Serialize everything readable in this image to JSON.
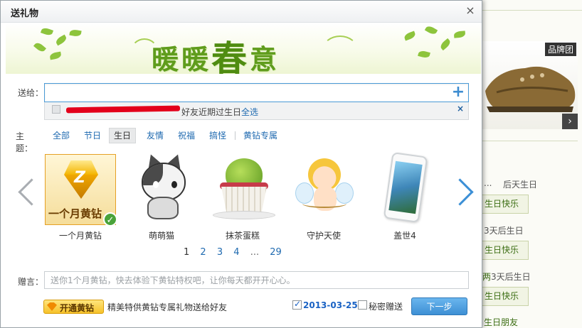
{
  "dialog": {
    "title": "送礼物",
    "close_symbol": "×",
    "banner_text": "暖暖",
    "banner_text_big": "春",
    "banner_text_end": "意",
    "recipient_label": "送给：",
    "add_symbol": "+",
    "suggestion": {
      "text": "好友近期过生日",
      "select_all": "全选",
      "close_symbol": "×"
    },
    "theme_label": "主题：",
    "tabs": [
      {
        "label": "全部",
        "active": false
      },
      {
        "label": "节日",
        "active": false
      },
      {
        "label": "生日",
        "active": true
      },
      {
        "label": "友情",
        "active": false
      },
      {
        "label": "祝福",
        "active": false
      },
      {
        "label": "搞怪",
        "active": false
      },
      {
        "label": "黄钻专属",
        "active": false
      }
    ],
    "gifts": [
      {
        "name": "一个月黄钻",
        "caption": "一个月黄钻",
        "selected": true
      },
      {
        "name": "萌萌猫",
        "selected": false
      },
      {
        "name": "抹茶蛋糕",
        "selected": false
      },
      {
        "name": "守护天使",
        "selected": false
      },
      {
        "name": "盖世4",
        "selected": false
      }
    ],
    "pager": {
      "current": "1",
      "pages": [
        "2",
        "3",
        "4"
      ],
      "ellipsis": "...",
      "last": "29"
    },
    "message_label": "赠言：",
    "message_placeholder": "送你1个月黄钻，快去体验下黄钻特权吧，让你每天都开开心心。",
    "open_vip_label": "开通黄钻",
    "promo_text": "精美特供黄钻专属礼物送给好友",
    "date": "2013-03-25",
    "date_checked": true,
    "secret_label": "秘密赠送",
    "secret_checked": false,
    "next_label": "下一步"
  },
  "background": {
    "brand_tag": "品牌团",
    "next_arrow": "›",
    "birthdays": [
      {
        "when": "后天生日",
        "prefix": "...",
        "button": "生日快乐"
      },
      {
        "when": "3天后生日",
        "button": "生日快乐"
      },
      {
        "when": "3天后生日",
        "prefix": "两",
        "button": "生日快乐"
      }
    ],
    "footer_link": "生日朋友"
  },
  "colors": {
    "link": "#1f6ab0",
    "accent_blue": "#3d8fd4",
    "banner_green": "#5f9c1c",
    "vip_gold": "#f6c22a"
  }
}
